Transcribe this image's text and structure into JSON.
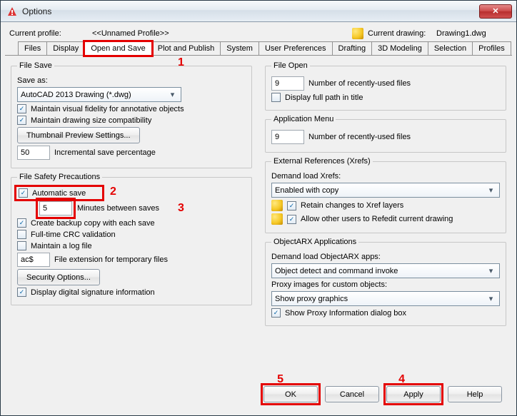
{
  "window_title": "Options",
  "profile": {
    "current_label": "Current profile:",
    "current_value": "<<Unnamed Profile>>",
    "drawing_label": "Current drawing:",
    "drawing_value": "Drawing1.dwg"
  },
  "tabs": {
    "files": "Files",
    "display": "Display",
    "open_and_save": "Open and Save",
    "plot": "Plot and Publish",
    "system": "System",
    "user_prefs": "User Preferences",
    "drafting": "Drafting",
    "modeling": "3D Modeling",
    "selection": "Selection",
    "profiles": "Profiles"
  },
  "file_save": {
    "legend": "File Save",
    "save_as_label": "Save as:",
    "save_as_value": "AutoCAD 2013 Drawing (*.dwg)",
    "visual_fidelity": "Maintain visual fidelity for annotative objects",
    "size_compat": "Maintain drawing size compatibility",
    "thumb_btn": "Thumbnail Preview Settings...",
    "incr_pct": "50",
    "incr_label": "Incremental save percentage"
  },
  "safety": {
    "legend": "File Safety Precautions",
    "auto_save": "Automatic save",
    "minutes": "5",
    "minutes_label": "Minutes between saves",
    "backup": "Create backup copy with each save",
    "crc": "Full-time CRC validation",
    "logfile": "Maintain a log file",
    "ext": "ac$",
    "ext_label": "File extension for temporary files",
    "sec_btn": "Security Options...",
    "dsig": "Display digital signature information"
  },
  "file_open": {
    "legend": "File Open",
    "recent": "9",
    "recent_label": "Number of recently-used files",
    "full_path": "Display full path in title"
  },
  "app_menu": {
    "legend": "Application Menu",
    "recent": "9",
    "recent_label": "Number of recently-used files"
  },
  "xrefs": {
    "legend": "External References (Xrefs)",
    "demand_label": "Demand load Xrefs:",
    "demand_value": "Enabled with copy",
    "retain": "Retain changes to Xref layers",
    "allow_refedit": "Allow other users to Refedit current drawing"
  },
  "arx": {
    "legend": "ObjectARX Applications",
    "demand_label": "Demand load ObjectARX apps:",
    "demand_value": "Object detect and command invoke",
    "proxy_label": "Proxy images for custom objects:",
    "proxy_value": "Show proxy graphics",
    "proxy_dialog": "Show Proxy Information dialog box"
  },
  "footer": {
    "ok": "OK",
    "cancel": "Cancel",
    "apply": "Apply",
    "help": "Help"
  },
  "annotations": {
    "a1": "1",
    "a2": "2",
    "a3": "3",
    "a4": "4",
    "a5": "5"
  }
}
